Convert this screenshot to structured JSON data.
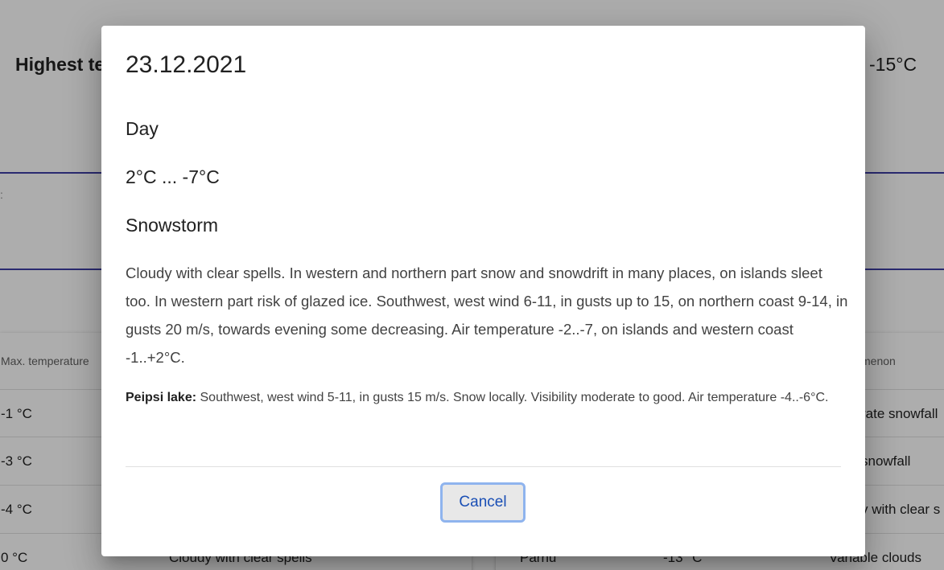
{
  "background": {
    "headline_left": "Highest te",
    "headline_right": "-15°C",
    "left_table": {
      "header": "Max. temperature",
      "rows": [
        {
          "max": "-1 °C",
          "desc": ""
        },
        {
          "max": "-3 °C",
          "desc": ""
        },
        {
          "max": "-4 °C",
          "desc": ""
        },
        {
          "max": "0 °C",
          "desc": "Cloudy with clear spells"
        }
      ]
    },
    "right_table": {
      "header": "menon",
      "rows": [
        {
          "place": "",
          "temp": "",
          "phen": "rate snowfall"
        },
        {
          "place": "",
          "temp": "",
          "phen": "snowfall"
        },
        {
          "place": "",
          "temp": "",
          "phen": "y with clear s"
        },
        {
          "place": "Parnu",
          "temp": "-13 °C",
          "phen": "Variable clouds"
        }
      ]
    }
  },
  "dialog": {
    "date": "23.12.2021",
    "period": "Day",
    "temperature": "2°C ... -7°C",
    "phenomenon": "Snowstorm",
    "forecast_text": "Cloudy with clear spells. In western and northern part snow and snowdrift in many places, on islands sleet too. In western part risk of glazed ice. Southwest, west wind 6-11, in gusts up to 15, on northern coast 9-14, in gusts 20 m/s, towards evening some decreasing. Air temperature -2..-7, on islands and western coast -1..+2°C.",
    "peipsi_label": "Peipsi lake:",
    "peipsi_text": " Southwest, west wind 5-11, in gusts 15 m/s. Snow locally. Visibility moderate to good. Air temperature -4..-6°C.",
    "cancel_label": "Cancel"
  }
}
